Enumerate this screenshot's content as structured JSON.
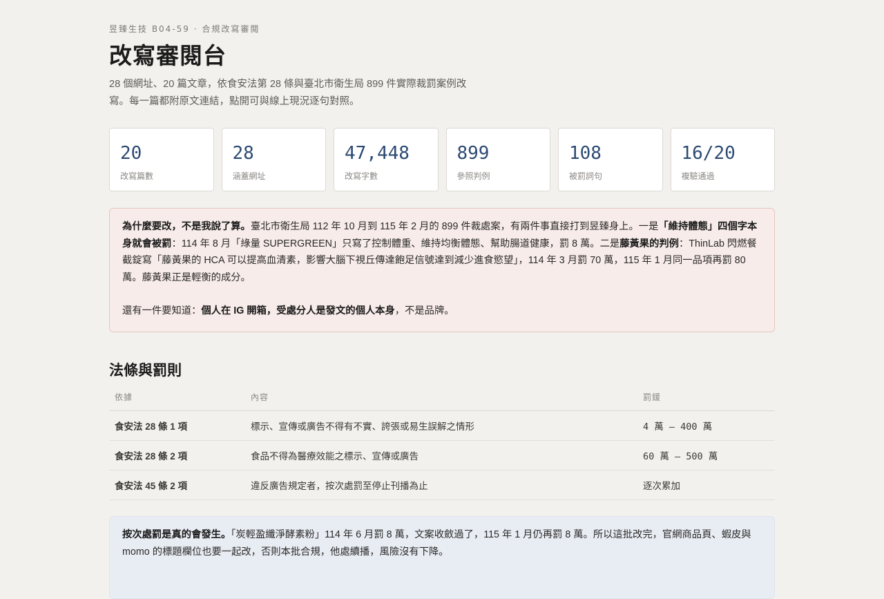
{
  "header": {
    "eyebrow": "昱臻生技 B04-59 · 合規改寫審閱",
    "title": "改寫審閱台",
    "intro": "28 個網址、20 篇文章，依食安法第 28 條與臺北市衛生局 899 件實際裁罰案例改寫。每一篇都附原文連結，點開可與線上現況逐句對照。"
  },
  "stats": [
    {
      "value": "20",
      "label": "改寫篇數"
    },
    {
      "value": "28",
      "label": "涵蓋網址"
    },
    {
      "value": "47,448",
      "label": "改寫字數"
    },
    {
      "value": "899",
      "label": "參照判例"
    },
    {
      "value": "108",
      "label": "被罰詞句"
    },
    {
      "value": "16/20",
      "label": "複驗通過"
    }
  ],
  "why_callout": {
    "p1_lead": "為什麼要改，不是我說了算。",
    "p1_text_a": "臺北市衛生局 112 年 10 月到 115 年 2 月的 899 件裁處案，有兩件事直接打到昱臻身上。一是",
    "p1_bold_a": "「維持體態」四個字本身就會被罰",
    "p1_text_b": "：114 年 8 月「綠量 SUPERGREEN」只寫了控制體重、維持均衡體態、幫助腸道健康，罰 8 萬。二是",
    "p1_bold_b": "藤黃果的判例",
    "p1_text_c": "：ThinLab 閃燃餐截錠寫「藤黃果的 HCA 可以提高血清素，影響大腦下視丘傳達飽足信號達到減少進食慾望」，114 年 3 月罰 70 萬，115 年 1 月同一品項再罰 80 萬。藤黃果正是輕衡的成分。",
    "p2_text_a": "還有一件要知道：",
    "p2_bold": "個人在 IG 開箱，受處分人是發文的個人本身",
    "p2_text_b": "，不是品牌。"
  },
  "rules_section": {
    "title": "法條與罰則",
    "columns": [
      "依據",
      "內容",
      "罰鍰"
    ],
    "rows": [
      {
        "law": "食安法 28 條 1 項",
        "content": "標示、宣傳或廣告不得有不實、誇張或易生誤解之情形",
        "fine": "4 萬 – 400 萬"
      },
      {
        "law": "食安法 28 條 2 項",
        "content": "食品不得為醫療效能之標示、宣傳或廣告",
        "fine": "60 萬 – 500 萬"
      },
      {
        "law": "食安法 45 條 2 項",
        "content": "違反廣告規定者，按次處罰至停止刊播為止",
        "fine": "逐次累加"
      }
    ]
  },
  "repeat_callout": {
    "lead": "按次處罰是真的會發生。",
    "text": "「炭輕盈纖淨酵素粉」114 年 6 月罰 8 萬，文案收斂過了，115 年 1 月仍再罰 8 萬。所以這批改完，官網商品頁、蝦皮與 momo 的標題欄位也要一起改，否則本批合規，他處續播，風險沒有下降。"
  }
}
